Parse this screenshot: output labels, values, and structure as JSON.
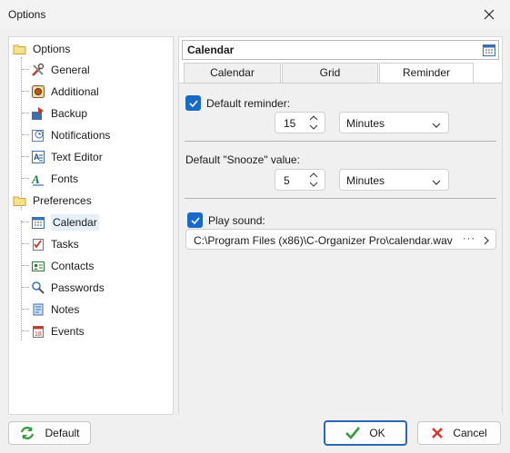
{
  "window": {
    "title": "Options"
  },
  "tree": {
    "groups": [
      {
        "label": "Options",
        "items": [
          "General",
          "Additional",
          "Backup",
          "Notifications",
          "Text Editor",
          "Fonts"
        ]
      },
      {
        "label": "Preferences",
        "items": [
          "Calendar",
          "Tasks",
          "Contacts",
          "Passwords",
          "Notes",
          "Events"
        ]
      }
    ],
    "selected": "Calendar"
  },
  "panel": {
    "title": "Calendar",
    "tabs": [
      "Calendar",
      "Grid",
      "Reminder"
    ],
    "active_tab": "Reminder"
  },
  "reminder": {
    "default_reminder_label": "Default reminder:",
    "default_reminder_checked": true,
    "default_reminder_value": "15",
    "default_reminder_unit": "Minutes",
    "snooze_label": "Default \"Snooze\" value:",
    "snooze_value": "5",
    "snooze_unit": "Minutes",
    "play_sound_label": "Play sound:",
    "play_sound_checked": true,
    "sound_path": "C:\\Program Files (x86)\\C-Organizer Pro\\calendar.wav",
    "browse_dots": "···"
  },
  "buttons": {
    "default": "Default",
    "ok": "OK",
    "cancel": "Cancel"
  },
  "colors": {
    "accent": "#1869c8",
    "ok_border": "#2b67b8",
    "selected_bg": "#e5f0fb"
  }
}
